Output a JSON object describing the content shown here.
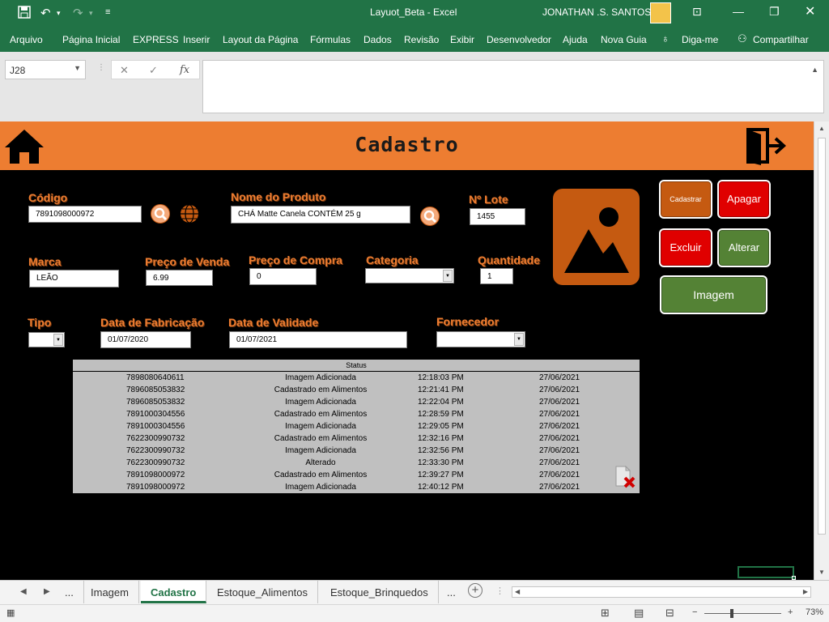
{
  "window": {
    "title": "Layuot_Beta  -  Excel",
    "user": "JONATHAN .S. SANTOS",
    "save_icon": "save-icon",
    "undo_icon": "undo-icon",
    "redo_icon": "redo-icon"
  },
  "ribbon": {
    "tabs": [
      "Arquivo",
      "Página Inicial",
      "EXPRESS",
      "Inserir",
      "Layout da Página",
      "Fórmulas",
      "Dados",
      "Revisão",
      "Exibir",
      "Desenvolvedor",
      "Ajuda",
      "Nova Guia"
    ],
    "tell_me": "Diga-me",
    "share": "Compartilhar"
  },
  "formula_bar": {
    "name_box": "J28",
    "formula": "",
    "fx": "fx"
  },
  "form": {
    "title": "Cadastro",
    "labels": {
      "codigo": "Código",
      "nome_produto": "Nome do Produto",
      "lote": "Nº Lote",
      "marca": "Marca",
      "preco_venda": "Preço de Venda",
      "preco_compra": "Preço de Compra",
      "categoria": "Categoria",
      "quantidade": "Quantidade",
      "tipo": "Tipo",
      "data_fabricacao": "Data de Fabricação",
      "data_validade": "Data de Validade",
      "fornecedor": "Fornecedor"
    },
    "values": {
      "codigo": "7891098000972",
      "nome_produto": "CHÁ Matte Canela CONTÉM 25 g",
      "lote": "1455",
      "marca": "LEÃO",
      "preco_venda": "6.99",
      "preco_compra": "0",
      "categoria": "",
      "quantidade": "1",
      "tipo": "",
      "data_fabricacao": "01/07/2020",
      "data_validade": "01/07/2021",
      "fornecedor": ""
    },
    "buttons": {
      "cadastrar": "Cadastrar",
      "apagar": "Apagar",
      "excluir": "Excluir",
      "alterar": "Alterar",
      "imagem": "Imagem"
    },
    "colors": {
      "accent": "#ed7d31",
      "red_button": "#e00000",
      "green_button": "#548235",
      "brown_button": "#c55a11"
    }
  },
  "status_table": {
    "header": "Status",
    "rows": [
      {
        "code": "7898080640611",
        "action": "Imagem Adicionada",
        "time": "12:18:03 PM",
        "date": "27/06/2021"
      },
      {
        "code": "7896085053832",
        "action": "Cadastrado em Alimentos",
        "time": "12:21:41 PM",
        "date": "27/06/2021"
      },
      {
        "code": "7896085053832",
        "action": "Imagem Adicionada",
        "time": "12:22:04 PM",
        "date": "27/06/2021"
      },
      {
        "code": "7891000304556",
        "action": "Cadastrado em Alimentos",
        "time": "12:28:59 PM",
        "date": "27/06/2021"
      },
      {
        "code": "7891000304556",
        "action": "Imagem Adicionada",
        "time": "12:29:05 PM",
        "date": "27/06/2021"
      },
      {
        "code": "7622300990732",
        "action": "Cadastrado em Alimentos",
        "time": "12:32:16 PM",
        "date": "27/06/2021"
      },
      {
        "code": "7622300990732",
        "action": "Imagem Adicionada",
        "time": "12:32:56 PM",
        "date": "27/06/2021"
      },
      {
        "code": "7622300990732",
        "action": "Alterado",
        "time": "12:33:30 PM",
        "date": "27/06/2021"
      },
      {
        "code": "7891098000972",
        "action": "Cadastrado em Alimentos",
        "time": "12:39:27 PM",
        "date": "27/06/2021"
      },
      {
        "code": "7891098000972",
        "action": "Imagem Adicionada",
        "time": "12:40:12 PM",
        "date": "27/06/2021"
      }
    ]
  },
  "sheet_tabs": {
    "ellipsis_left": "...",
    "tabs": [
      "Imagem",
      "Cadastro",
      "Estoque_Alimentos",
      "Estoque_Brinquedos"
    ],
    "active": "Cadastro",
    "ellipsis_right": "..."
  },
  "status_bar": {
    "zoom": "73%",
    "minus": "−",
    "plus": "+"
  }
}
